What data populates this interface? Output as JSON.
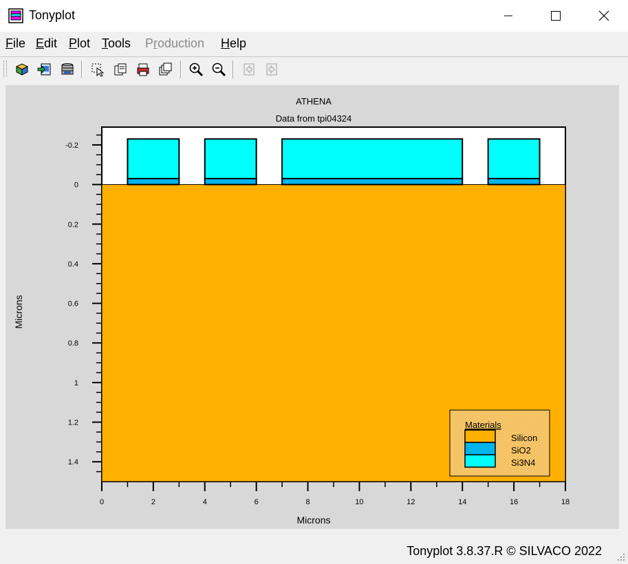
{
  "window": {
    "title": "Tonyplot"
  },
  "menu": [
    {
      "label": "File",
      "u": "F",
      "rest": "ile",
      "disabled": false
    },
    {
      "label": "Edit",
      "u": "E",
      "rest": "dit",
      "disabled": false
    },
    {
      "label": "Plot",
      "u": "P",
      "rest": "lot",
      "disabled": false
    },
    {
      "label": "Tools",
      "u": "T",
      "rest": "ools",
      "disabled": false
    },
    {
      "label": "Production",
      "pre": "P",
      "u": "r",
      "rest": "oduction",
      "disabled": true
    },
    {
      "label": "Help",
      "u": "H",
      "rest": "elp",
      "disabled": false
    }
  ],
  "toolbar": {
    "icons": [
      "load-icon",
      "import-icon",
      "save-icon",
      "select-icon",
      "copy-icon",
      "print-icon",
      "duplicate-icon",
      "zoom-in-icon",
      "zoom-out-icon",
      "prev-icon",
      "next-icon"
    ]
  },
  "plot": {
    "title": "ATHENA",
    "subtitle": "Data from tpi04324",
    "xlabel": "Microns",
    "ylabel": "Microns",
    "x_ticks": [
      "0",
      "2",
      "4",
      "6",
      "8",
      "10",
      "12",
      "14",
      "16",
      "18"
    ],
    "y_ticks": [
      "-0.2",
      "0",
      "0.2",
      "0.4",
      "0.6",
      "0.8",
      "1",
      "1.2",
      "1.4"
    ],
    "legend": {
      "title": "Materials",
      "items": [
        {
          "name": "Silicon",
          "color": "#ffb000"
        },
        {
          "name": "SiO2",
          "color": "#00b4f0"
        },
        {
          "name": "Si3N4",
          "color": "#00ffff"
        }
      ]
    }
  },
  "chart_data": {
    "type": "structure",
    "title": "ATHENA",
    "subtitle": "Data from tpi04324",
    "xlabel": "Microns",
    "ylabel": "Microns",
    "xlim": [
      0,
      18
    ],
    "ylim": [
      -0.29,
      1.5
    ],
    "materials": [
      "Silicon",
      "SiO2",
      "Si3N4"
    ],
    "regions": [
      {
        "material": "Silicon",
        "x": [
          0,
          18
        ],
        "y": [
          0,
          1.5
        ]
      },
      {
        "material": "SiO2",
        "x": [
          1,
          3
        ],
        "y": [
          -0.03,
          0
        ]
      },
      {
        "material": "Si3N4",
        "x": [
          1,
          3
        ],
        "y": [
          -0.23,
          -0.03
        ]
      },
      {
        "material": "SiO2",
        "x": [
          4,
          6
        ],
        "y": [
          -0.03,
          0
        ]
      },
      {
        "material": "Si3N4",
        "x": [
          4,
          6
        ],
        "y": [
          -0.23,
          -0.03
        ]
      },
      {
        "material": "SiO2",
        "x": [
          7,
          14
        ],
        "y": [
          -0.03,
          0
        ]
      },
      {
        "material": "Si3N4",
        "x": [
          7,
          14
        ],
        "y": [
          -0.23,
          -0.03
        ]
      },
      {
        "material": "SiO2",
        "x": [
          15,
          17
        ],
        "y": [
          -0.03,
          0
        ]
      },
      {
        "material": "Si3N4",
        "x": [
          15,
          17
        ],
        "y": [
          -0.23,
          -0.03
        ]
      }
    ]
  },
  "status": {
    "text": "Tonyplot 3.8.37.R © SILVACO 2022"
  }
}
